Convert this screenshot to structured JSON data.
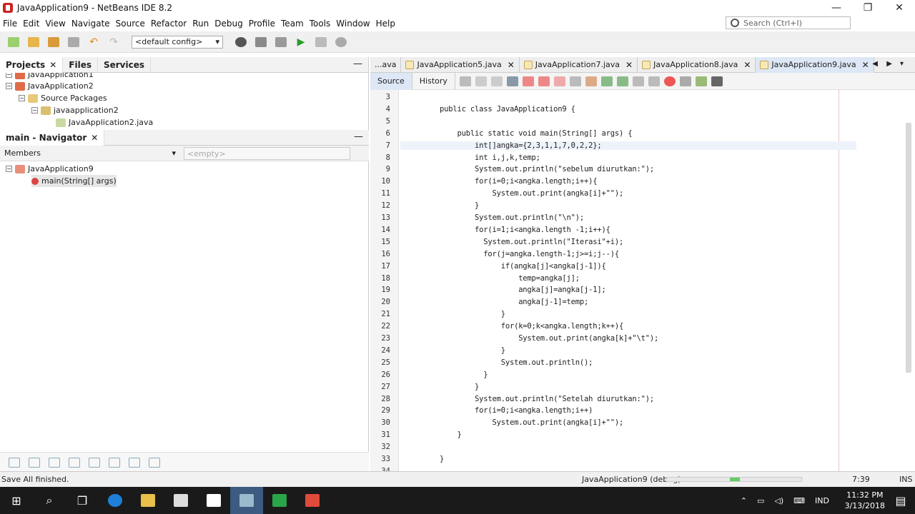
{
  "window": {
    "title": "JavaApplication9 - NetBeans IDE 8.2",
    "minimize": "—",
    "maximize": "❐",
    "close": "✕"
  },
  "menu": [
    "File",
    "Edit",
    "View",
    "Navigate",
    "Source",
    "Refactor",
    "Run",
    "Debug",
    "Profile",
    "Team",
    "Tools",
    "Window",
    "Help"
  ],
  "search": {
    "placeholder": "Search (Ctrl+I)"
  },
  "toolbar": {
    "config": "<default config>"
  },
  "projects_panel": {
    "tabs": [
      "Projects",
      "Files",
      "Services"
    ],
    "tree": [
      {
        "label": "JavaApplication1"
      },
      {
        "label": "JavaApplication2"
      },
      {
        "label": "Source Packages"
      },
      {
        "label": "javaapplication2"
      },
      {
        "label": "JavaApplication2.java"
      }
    ]
  },
  "navigator": {
    "title": "main - Navigator",
    "filter": "Members",
    "empty": "<empty>",
    "tree": [
      {
        "label": "JavaApplication9"
      },
      {
        "label": "main(String[] args)"
      }
    ]
  },
  "editor": {
    "tabs": [
      {
        "label": "...ava"
      },
      {
        "label": "JavaApplication5.java"
      },
      {
        "label": "JavaApplication7.java"
      },
      {
        "label": "JavaApplication8.java"
      },
      {
        "label": "JavaApplication9.java"
      }
    ],
    "modes": {
      "source": "Source",
      "history": "History"
    },
    "lines": [
      {
        "n": "3",
        "t": ""
      },
      {
        "n": "4",
        "t": "public class JavaApplication9 {"
      },
      {
        "n": "5",
        "t": ""
      },
      {
        "n": "6",
        "t": "    public static void main(String[] args) {"
      },
      {
        "n": "7",
        "t": "        int[]angka={2,3,1,1,7,0,2,2};"
      },
      {
        "n": "8",
        "t": "        int i,j,k,temp;"
      },
      {
        "n": "9",
        "t": "        System.out.println(\"sebelum diurutkan:\");"
      },
      {
        "n": "10",
        "t": "        for(i=0;i<angka.length;i++){"
      },
      {
        "n": "11",
        "t": "            System.out.print(angka[i]+\"\");"
      },
      {
        "n": "12",
        "t": "        }"
      },
      {
        "n": "13",
        "t": "        System.out.println(\"\\n\");"
      },
      {
        "n": "14",
        "t": "        for(i=1;i<angka.length -1;i++){"
      },
      {
        "n": "15",
        "t": "          System.out.println(\"Iterasi\"+i);"
      },
      {
        "n": "16",
        "t": "          for(j=angka.length-1;j>=i;j--){"
      },
      {
        "n": "17",
        "t": "              if(angka[j]<angka[j-1]){"
      },
      {
        "n": "18",
        "t": "                  temp=angka[j];"
      },
      {
        "n": "19",
        "t": "                  angka[j]=angka[j-1];"
      },
      {
        "n": "20",
        "t": "                  angka[j-1]=temp;"
      },
      {
        "n": "21",
        "t": "              }"
      },
      {
        "n": "22",
        "t": "              for(k=0;k<angka.length;k++){"
      },
      {
        "n": "23",
        "t": "                  System.out.print(angka[k]+\"\\t\");"
      },
      {
        "n": "24",
        "t": "              }"
      },
      {
        "n": "25",
        "t": "              System.out.println();"
      },
      {
        "n": "26",
        "t": "          }"
      },
      {
        "n": "27",
        "t": "        }"
      },
      {
        "n": "28",
        "t": "        System.out.println(\"Setelah diurutkan:\");"
      },
      {
        "n": "29",
        "t": "        for(i=0;i<angka.length;i++)"
      },
      {
        "n": "30",
        "t": "            System.out.print(angka[i]+\"\");"
      },
      {
        "n": "31",
        "t": "    }"
      },
      {
        "n": "32",
        "t": ""
      },
      {
        "n": "33",
        "t": "}"
      },
      {
        "n": "34",
        "t": ""
      }
    ]
  },
  "status": {
    "message": "Save All finished.",
    "project": "JavaApplication9 (debug)",
    "position": "7:39",
    "mode": "INS"
  },
  "taskbar": {
    "lang": "IND",
    "time": "11:32 PM",
    "date": "3/13/2018"
  }
}
